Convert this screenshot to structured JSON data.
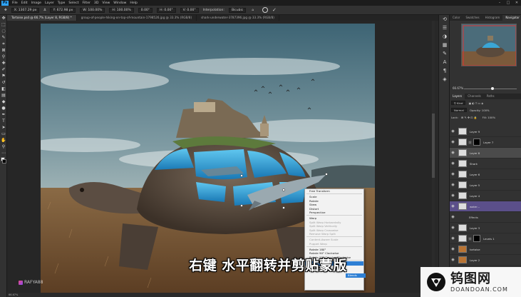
{
  "menubar": {
    "logo": "Ps",
    "items": [
      "File",
      "Edit",
      "Image",
      "Layer",
      "Type",
      "Select",
      "Filter",
      "3D",
      "View",
      "Window",
      "Help"
    ]
  },
  "optbar": {
    "fields": [
      "X: 1307.29 px",
      "Δ",
      "Y: 672.98 px",
      "W: 100.00%",
      "H: 100.00%",
      "0.00°",
      "H: 0.00°",
      "V: 0.00°",
      "Interpolation:",
      "Bicubic"
    ]
  },
  "tabs": [
    {
      "label": "Tortoise.psd @ 66.7% (Layer 8, RGB/8) *",
      "active": true
    },
    {
      "label": "group-of-people-hiking-on-top-of-mountain-1798526.jpg @ 33.3% (RGB/8)",
      "active": false
    },
    {
      "label": "shark-underwater-3787396.jpg @ 33.3% (RGB/8)",
      "active": false
    }
  ],
  "context_menu": {
    "items": [
      {
        "label": "Free Transform",
        "state": "normal"
      },
      {
        "sep": true
      },
      {
        "label": "Scale",
        "state": "normal"
      },
      {
        "label": "Rotate",
        "state": "normal"
      },
      {
        "label": "Skew",
        "state": "normal"
      },
      {
        "label": "Distort",
        "state": "normal"
      },
      {
        "label": "Perspective",
        "state": "normal"
      },
      {
        "sep": true
      },
      {
        "label": "Warp",
        "state": "normal"
      },
      {
        "label": "Split Warp Horizontally",
        "state": "disabled"
      },
      {
        "label": "Split Warp Vertically",
        "state": "disabled"
      },
      {
        "label": "Split Warp Crosswise",
        "state": "disabled"
      },
      {
        "label": "Remove Warp Split",
        "state": "disabled"
      },
      {
        "sep": true
      },
      {
        "label": "Content-Aware Scale",
        "state": "disabled"
      },
      {
        "label": "Puppet Warp",
        "state": "disabled"
      },
      {
        "sep": true
      },
      {
        "label": "Rotate 180°",
        "state": "normal"
      },
      {
        "label": "Rotate 90° Clockwise",
        "state": "normal"
      },
      {
        "label": "Rotate 90° Counter Clockwise",
        "state": "normal"
      },
      {
        "sep": true
      },
      {
        "label": "Flip Horizontal",
        "state": "highlight"
      },
      {
        "label": "Flip Vertical",
        "state": "normal"
      }
    ],
    "submenu_label": "Blends"
  },
  "subtitle": "右键 水平翻转并剪贴蒙版",
  "watermark_left": "RAFYA88",
  "statusbar": "66.67%",
  "right_panel": {
    "top_tabs": [
      "Color",
      "Swatches",
      "Histogram",
      "Navigator"
    ],
    "active_top_tab": "Navigator",
    "zoom_label": "66.67%",
    "layer_tabs": [
      "Layers",
      "Channels",
      "Paths"
    ],
    "blend_mode": "Normal",
    "opacity_label": "Opacity: 100%",
    "fill_label": "Fill: 100%",
    "lock_label": "Lock:",
    "layers": [
      {
        "name": "Layer 9",
        "selected": false,
        "kind": "normal"
      },
      {
        "name": "Layer 7",
        "selected": false,
        "kind": "mask"
      },
      {
        "name": "Layer 8",
        "selected": true,
        "kind": "normal"
      },
      {
        "name": "Shark",
        "selected": false,
        "kind": "normal"
      },
      {
        "name": "Layer 6",
        "selected": false,
        "kind": "normal"
      },
      {
        "name": "Layer 5",
        "selected": false,
        "kind": "normal"
      },
      {
        "name": "Layer 4",
        "selected": false,
        "kind": "normal"
      },
      {
        "name": "water...",
        "selected": false,
        "kind": "purple"
      },
      {
        "name": "Effects",
        "selected": false,
        "kind": "fx"
      },
      {
        "name": "Layer 3",
        "selected": false,
        "kind": "normal"
      },
      {
        "name": "Levels 1",
        "selected": false,
        "kind": "mask"
      },
      {
        "name": "tortoise",
        "selected": false,
        "kind": "orange"
      },
      {
        "name": "Layer 2",
        "selected": false,
        "kind": "orange"
      }
    ],
    "sub_effects": [
      "Effects",
      "Inner Shadow"
    ]
  },
  "watermark_right": {
    "cn": "钨图网",
    "en": "DOANDOAN.COM"
  }
}
